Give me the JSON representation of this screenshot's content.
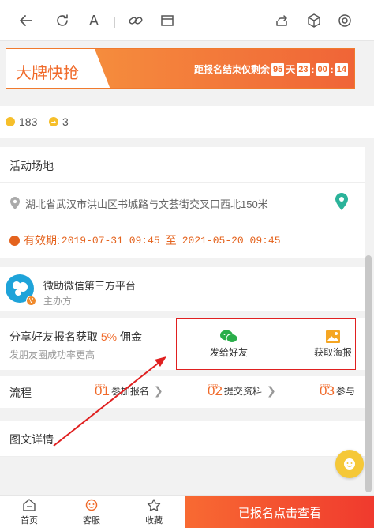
{
  "toolbar": {
    "icons": [
      "back-arrow-icon",
      "refresh-icon",
      "text-size-icon",
      "link-icon",
      "window-icon",
      "share-icon",
      "box-icon",
      "settings-icon"
    ],
    "text_size_glyph": "A"
  },
  "banner": {
    "title": "大牌快抢",
    "countdown_prefix": "距报名结束仅剩余",
    "days": "95",
    "day_unit": "天",
    "hours": "23",
    "minutes": "00",
    "seconds": "14"
  },
  "stats": {
    "coins": "183",
    "shares": "3"
  },
  "venue": {
    "title": "活动场地",
    "address": "湖北省武汉市洪山区书城路与文荟街交叉口西北150米",
    "validity_label": "有效期:",
    "validity_start": "2019-07-31 09:45",
    "validity_to": "至",
    "validity_end": "2021-05-20 09:45"
  },
  "host": {
    "name": "微助微信第三方平台",
    "role": "主办方",
    "badge": "V"
  },
  "share": {
    "title_prefix": "分享好友报名获取",
    "percent": "5%",
    "title_suffix": "佣金",
    "subtitle": "发朋友圈成功率更高",
    "send_friend": "发给好友",
    "get_poster": "获取海报"
  },
  "flow": {
    "title": "流程",
    "step_tag": "STEP",
    "steps": [
      {
        "num": "01",
        "label": "参加报名"
      },
      {
        "num": "02",
        "label": "提交资料"
      },
      {
        "num": "03",
        "label": "参与"
      }
    ]
  },
  "details": {
    "title": "图文详情"
  },
  "bottom_nav": {
    "home": "首页",
    "service": "客服",
    "favorite": "收藏",
    "cta": "已报名点击查看"
  },
  "colors": {
    "accent": "#f06a2a",
    "annotation": "#e02020",
    "wechat_green": "#2aae4a"
  }
}
